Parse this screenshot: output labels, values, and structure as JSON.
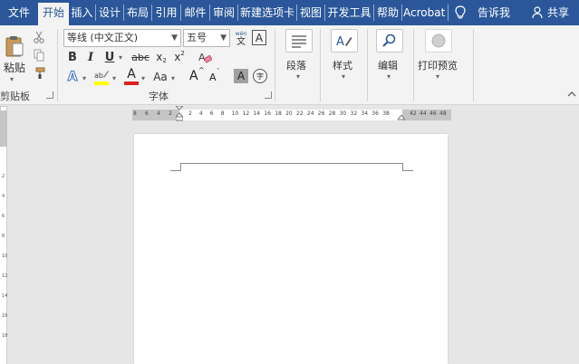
{
  "tabs": [
    {
      "label": "文件"
    },
    {
      "label": "开始"
    },
    {
      "label": "插入"
    },
    {
      "label": "设计"
    },
    {
      "label": "布局"
    },
    {
      "label": "引用"
    },
    {
      "label": "邮件"
    },
    {
      "label": "审阅"
    },
    {
      "label": "新建选项卡"
    },
    {
      "label": "视图"
    },
    {
      "label": "开发工具"
    },
    {
      "label": "帮助"
    },
    {
      "label": "Acrobat"
    }
  ],
  "tell_me": "告诉我",
  "share": "共享",
  "clipboard": {
    "paste_label": "粘贴",
    "group_label": "剪贴板"
  },
  "font": {
    "font_name": "等线 (中文正文)",
    "font_size": "五号",
    "group_label": "字体",
    "bold": "B",
    "italic": "I",
    "underline": "U",
    "strike": "abc",
    "subscript": "x",
    "subscript_mark": "2",
    "superscript": "x",
    "superscript_mark": "2",
    "text_effects": "A",
    "font_color": "A",
    "change_case": "Aa",
    "grow": "A",
    "shrink": "A",
    "char_shading": "A",
    "phonetic_top": "wén",
    "phonetic_bottom": "文",
    "border_char": "A",
    "enclose": "字"
  },
  "paragraph": {
    "label": "段落"
  },
  "styles": {
    "label": "样式"
  },
  "editing": {
    "label": "编辑"
  },
  "print_preview": {
    "label": "打印预览"
  },
  "ruler": {
    "left_nums": [
      "8",
      "6",
      "4",
      "2"
    ],
    "mid_nums": [
      "2",
      "4",
      "6",
      "8",
      "10",
      "12",
      "14",
      "16",
      "18",
      "20",
      "22",
      "24",
      "26",
      "28",
      "30",
      "32",
      "34",
      "36",
      "38"
    ],
    "right_nums": [
      "42",
      "44",
      "46",
      "48"
    ]
  },
  "vruler_nums": [
    "2",
    "4",
    "6",
    "8",
    "10",
    "12",
    "14",
    "16",
    "18"
  ],
  "colors": {
    "accent": "#2b579a",
    "ribbon": "#f3f3f3",
    "workspace": "#e6e6e6",
    "highlight": "#ffff00",
    "font_color": "#d22"
  }
}
